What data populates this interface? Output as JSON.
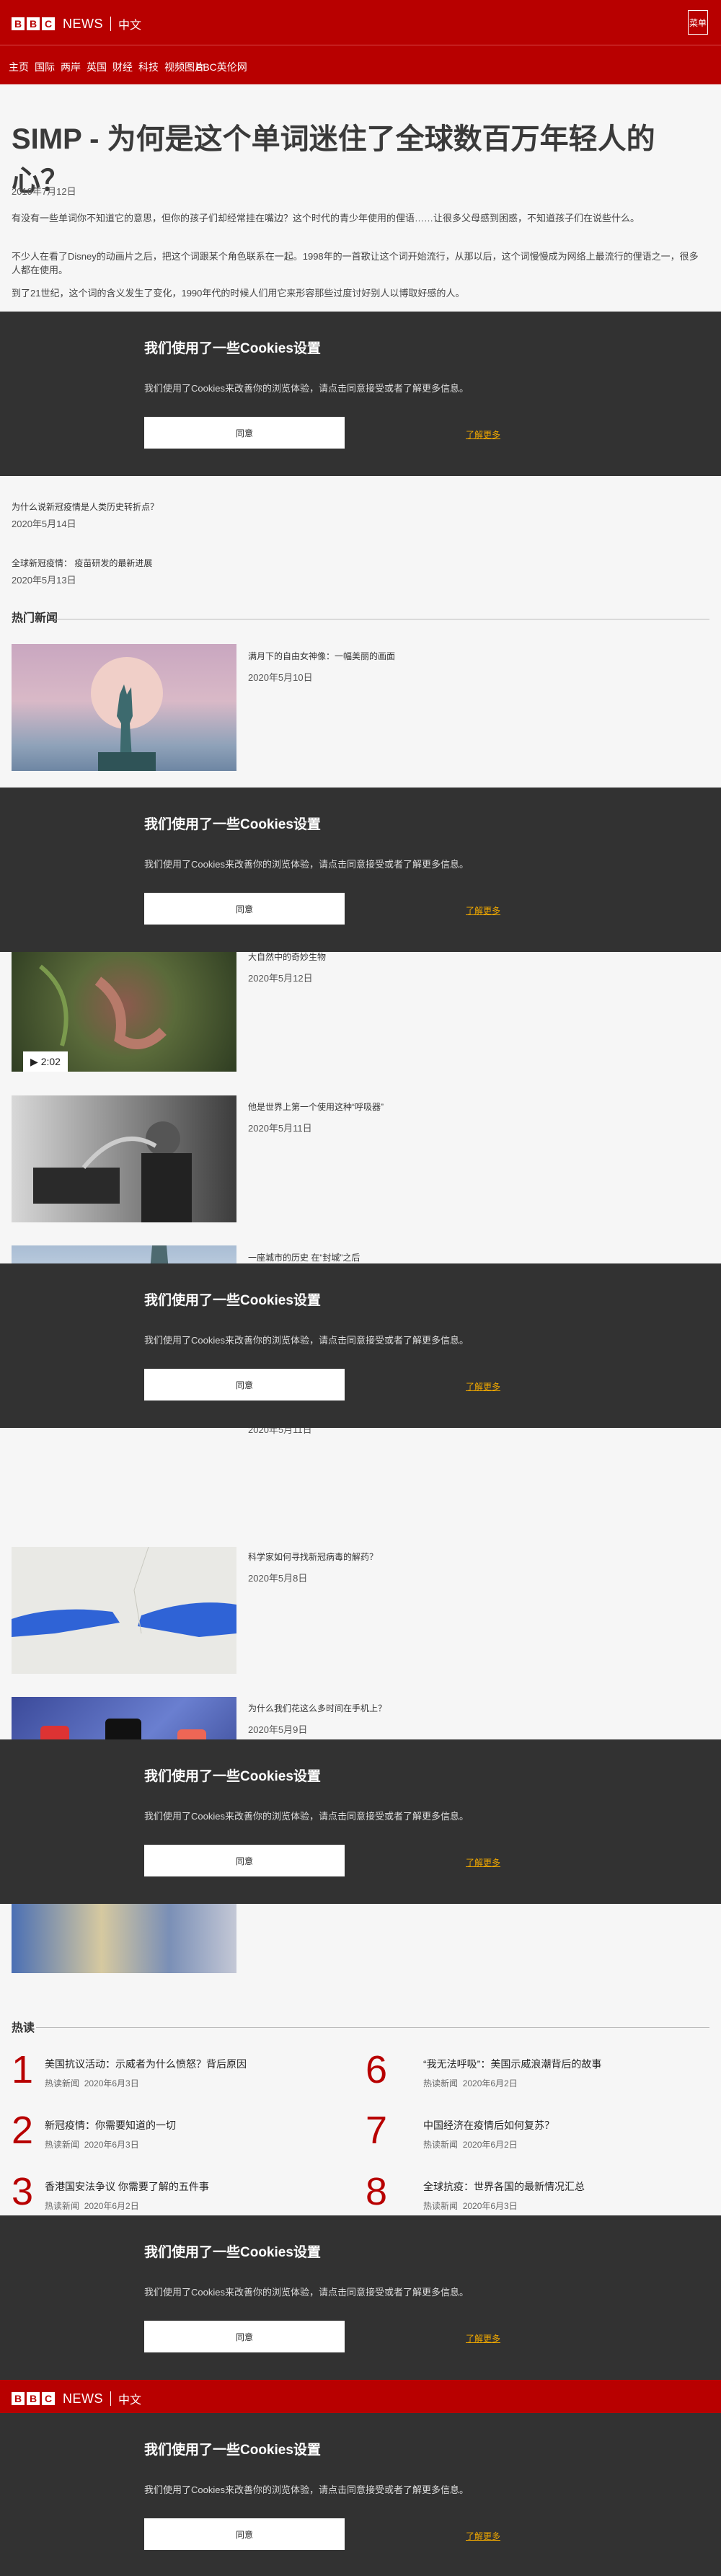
{
  "header": {
    "logo_letters": [
      "B",
      "B",
      "C"
    ],
    "news_label": "NEWS",
    "lang_label": "中文",
    "menu_icon": "menu-icon",
    "menu_label": "菜单"
  },
  "nav": {
    "items": [
      "主页",
      "国际",
      "两岸",
      "英国",
      "财经",
      "科技",
      "视频图片",
      "BBC英伦网"
    ]
  },
  "article": {
    "title": "SIMP - 为何是这个单词迷住了全球数百万年轻人的心？",
    "date": "2019年7月12日",
    "paragraphs": [
      "有没有一些单词你不知道它的意思，但你的孩子们却经常挂在嘴边？这个时代的青少年使用的俚语……让很多父母感到困惑，不知道孩子们在说些什么。",
      "不少人在看了Disney的动画片之后，把这个词跟某个角色联系在一起。1998年的一首歌让这个词开始流行，从那以后，这个词慢慢成为网络上最流行的俚语之一，很多人都在使用。",
      "到了21世纪，这个词的含义发生了变化，1990年代的时候人们用它来形容那些过度讨好别人以博取好感的人。"
    ]
  },
  "cookie": {
    "title": "我们使用了一些Cookies设置",
    "text": "我们使用了Cookies来改善你的浏览体验，请点击同意接受或者了解更多信息。",
    "ok_label": "同意",
    "more_label": "了解更多"
  },
  "related": [
    {
      "title": "为什么说新冠疫情是人类历史转折点？",
      "date": "2020年5月14日"
    },
    {
      "title": "全球新冠疫情： 疫苗研发的最新进展",
      "date": "2020年5月13日"
    }
  ],
  "sections": {
    "top_stories": "热门新闻",
    "most_read": "热读"
  },
  "stories": [
    {
      "title": "满月下的自由女神像：一幅美丽的画面",
      "date": "2020年5月10日"
    },
    {
      "title": "大自然中的奇妙生物",
      "date": "2020年5月12日",
      "duration": "2:02"
    },
    {
      "title": "他是世界上第一个使用这种“呼吸器”",
      "date": "2020年5月11日"
    },
    {
      "title": "一座城市的历史 在“封城”之后",
      "date": "2020年5月11日"
    },
    {
      "title": "科学家如何寻找新冠病毒的解药？",
      "date": "2020年5月8日"
    },
    {
      "title": "为什么我们花这么多时间在手机上？",
      "date": "2020年5月9日"
    }
  ],
  "most_read": [
    {
      "rank": "1",
      "title": "美国抗议活动：示威者为什么愤怒？背后原因",
      "label": "热读新闻",
      "date": "2020年6月3日"
    },
    {
      "rank": "2",
      "title": "新冠疫情：你需要知道的一切",
      "label": "热读新闻",
      "date": "2020年6月3日"
    },
    {
      "rank": "3",
      "title": "香港国安法争议 你需要了解的五件事",
      "label": "热读新闻",
      "date": "2020年6月2日"
    },
    {
      "rank": "6",
      "title": "“我无法呼吸”：美国示威浪潮背后的故事",
      "label": "热读新闻",
      "date": "2020年6月2日"
    },
    {
      "rank": "7",
      "title": "中国经济在疫情后如何复苏？",
      "label": "热读新闻",
      "date": "2020年6月2日"
    },
    {
      "rank": "8",
      "title": "全球抗疫：世界各国的最新情况汇总",
      "label": "热读新闻",
      "date": "2020年6月3日"
    }
  ],
  "colors": {
    "brand_red": "#b80000",
    "cookie_bg": "#323232",
    "cookie_link": "#f0a800"
  }
}
